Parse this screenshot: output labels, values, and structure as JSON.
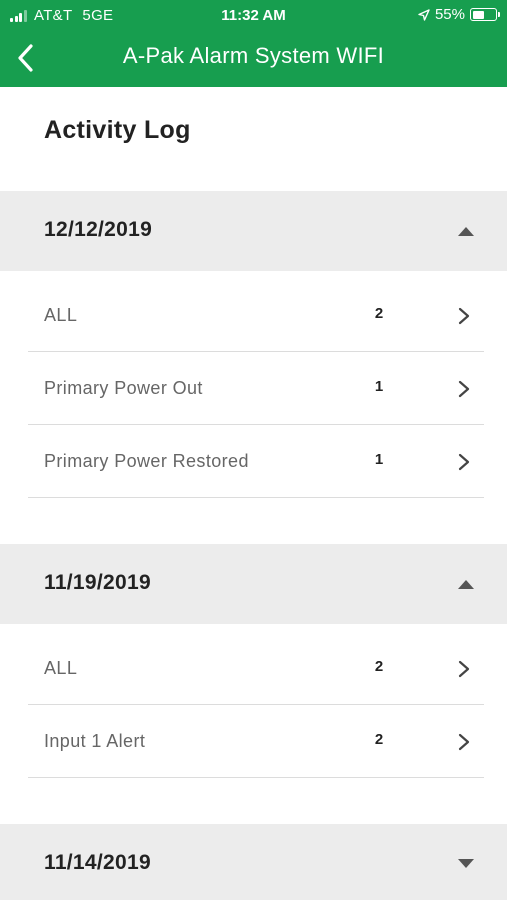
{
  "status_bar": {
    "carrier": "AT&T",
    "network": "5GE",
    "time": "11:32 AM",
    "battery_text": "55%",
    "battery_level": 0.55,
    "signal_bars": 3
  },
  "nav": {
    "title": "A-Pak Alarm System WIFI",
    "back_icon": "chevron-left-icon"
  },
  "page_title": "Activity Log",
  "colors": {
    "header_green": "#179e4f",
    "section_bg": "#ececec",
    "divider": "#dcdcdc"
  },
  "sections": [
    {
      "date": "12/12/2019",
      "expanded": true,
      "rows": [
        {
          "label": "ALL",
          "count": "2"
        },
        {
          "label": "Primary Power Out",
          "count": "1"
        },
        {
          "label": "Primary Power Restored",
          "count": "1"
        }
      ]
    },
    {
      "date": "11/19/2019",
      "expanded": true,
      "rows": [
        {
          "label": "ALL",
          "count": "2"
        },
        {
          "label": "Input 1 Alert",
          "count": "2"
        }
      ]
    },
    {
      "date": "11/14/2019",
      "expanded": false,
      "rows": []
    }
  ]
}
